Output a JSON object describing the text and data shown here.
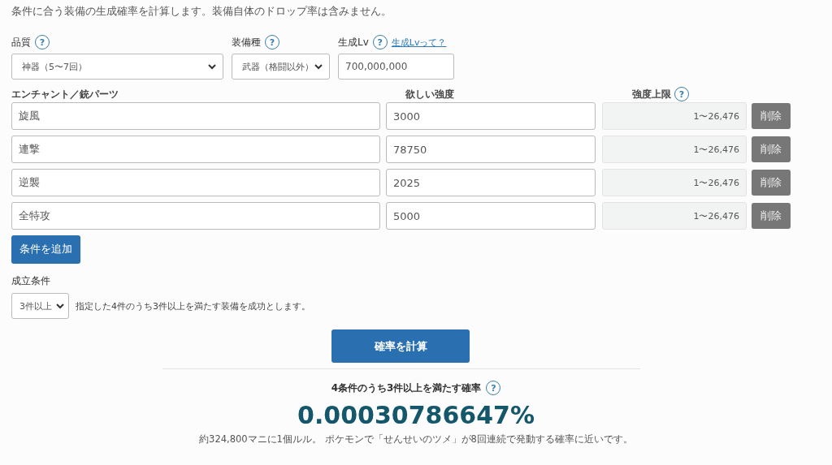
{
  "intro": "条件に合う装備の生成確率を計算します。装備自体のドロップ率は含みません。",
  "fields": [
    {
      "kind": "select",
      "label": "品質",
      "help": "?",
      "value": "神器（5〜7回）"
    },
    {
      "kind": "select",
      "label": "装備種",
      "help": "?",
      "value": "武器（格闘以外）"
    },
    {
      "kind": "input",
      "label": "生成Lv",
      "help": "?",
      "link": "生成Lvって？",
      "value": "700,000,000"
    }
  ],
  "conditions": {
    "columns": [
      {
        "label": "エンチャント／銃パーツ"
      },
      {
        "label": "欲しい強度"
      },
      {
        "label": "強度上限",
        "help": "?"
      }
    ],
    "rows": [
      {
        "enchant": "旋風",
        "strength": "3000",
        "limit": "1〜26,476",
        "delete": "削除"
      },
      {
        "enchant": "連撃",
        "strength": "78750",
        "limit": "1〜26,476",
        "delete": "削除"
      },
      {
        "enchant": "逆襲",
        "strength": "2025",
        "limit": "1〜26,476",
        "delete": "削除"
      },
      {
        "enchant": "全特攻",
        "strength": "5000",
        "limit": "1〜26,476",
        "delete": "削除"
      }
    ]
  },
  "add_button": "条件を追加",
  "success": {
    "label": "成立条件",
    "value": "3件以上",
    "description": "指定した4件のうち3件以上を満たす装備を成功とします。"
  },
  "calculate_button": "確率を計算",
  "result": {
    "title": "4条件のうち3件以上を満たす確率",
    "help": "?",
    "value": "0.00030786647%",
    "note": "約324,800マニに1個ルル。 ポケモンで「せんせいのツメ」が8回連続で発動する確率に近いです。"
  }
}
